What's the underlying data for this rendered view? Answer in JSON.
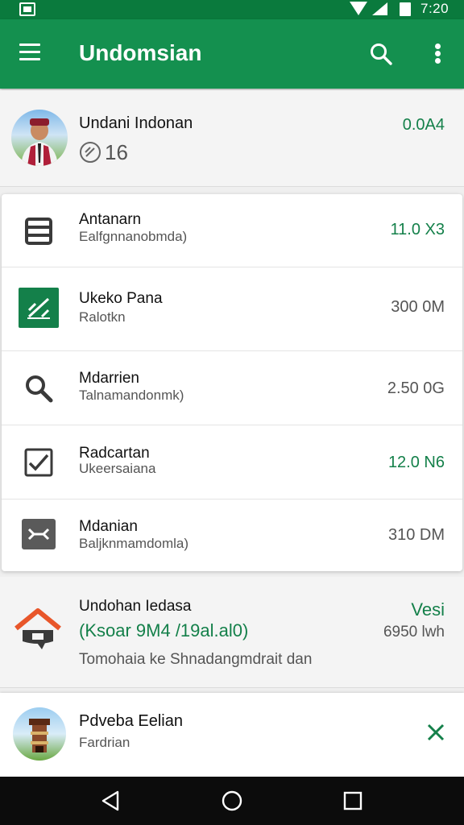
{
  "status_bar": {
    "time": "7:20"
  },
  "app_bar": {
    "title": "Undomsian",
    "menu_icon": "hamburger-menu-icon",
    "search_icon": "search-icon",
    "more_icon": "more-vert-icon"
  },
  "profile": {
    "name": "Undani Indonan",
    "count": "16",
    "balance": "0.0A4"
  },
  "list": [
    {
      "icon": "list-icon",
      "title": "Antanarn",
      "subtitle": "Ealfgnnanobmda)",
      "value": "11.0 X3",
      "value_color": "#14804a"
    },
    {
      "icon": "chart-icon",
      "title": "Ukeko Pana",
      "subtitle": "Ralotkn",
      "value": "300 0M",
      "value_color": "#555555"
    },
    {
      "icon": "search-icon",
      "title": "Mdarrien",
      "subtitle": "Talnamandonmk)",
      "value": "2.50 0G",
      "value_color": "#555555"
    },
    {
      "icon": "checkbox-icon",
      "title": "Radcartan",
      "subtitle": "Ukeersaiana",
      "value": "12.0 N6",
      "value_color": "#14804a"
    },
    {
      "icon": "close-box-icon",
      "title": "Mdanian",
      "subtitle": "Baljknmamdomla)",
      "value": "310 DM",
      "value_color": "#555555"
    }
  ],
  "promo": {
    "icon": "house-icon",
    "title": "Undohan Iedasa",
    "highlight": "(Ksoar 9M4 /19al.al0)",
    "description": "Tomohaia ke Shnadangmdrait dan",
    "badge": "Vesi",
    "value": "6950 lwh"
  },
  "notification": {
    "title": "Pdveba Eelian",
    "subtitle": "Fardrian",
    "close_icon": "close-icon"
  },
  "nav_bar": {
    "back_icon": "back-icon",
    "home_icon": "home-icon",
    "recents_icon": "recents-icon"
  },
  "colors": {
    "primary": "#14904f",
    "primary_dark": "#0a7a3d",
    "accent_text": "#14804a"
  }
}
